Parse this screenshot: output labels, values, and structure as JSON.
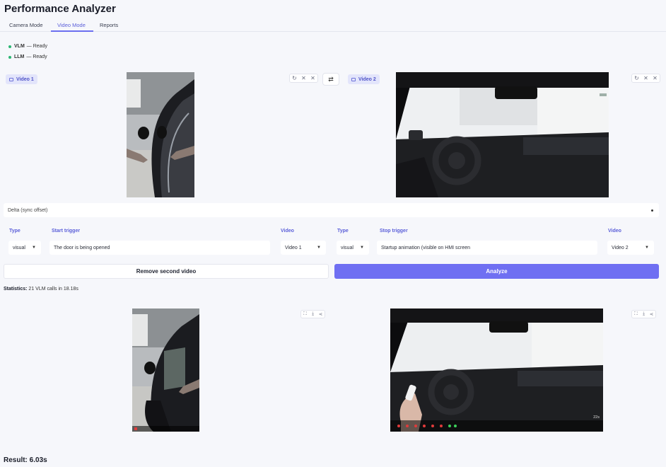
{
  "app": {
    "title": "Performance Analyzer"
  },
  "tabs": [
    {
      "label": "Camera Mode",
      "active": false
    },
    {
      "label": "Video Mode",
      "active": true
    },
    {
      "label": "Reports",
      "active": false
    }
  ],
  "status": [
    {
      "name": "VLM",
      "state": "— Ready"
    },
    {
      "name": "LLM",
      "state": "— Ready"
    }
  ],
  "videos": {
    "left": {
      "label": "Video 1"
    },
    "right": {
      "label": "Video 2"
    },
    "controls": {
      "reset_icon": "reset-icon",
      "close_icon": "close-icon"
    },
    "swap_icon": "swap-icon"
  },
  "delta": {
    "label": "Delta (sync offset)"
  },
  "start": {
    "type_label": "Type",
    "type_value": "visual",
    "trigger_label": "Start trigger",
    "trigger_value": "The door is being opened",
    "video_label": "Video",
    "video_value": "Video 1"
  },
  "stop": {
    "type_label": "Type",
    "type_value": "visual",
    "trigger_label": "Stop trigger",
    "trigger_value": "Startup animation (visible on HMI screen",
    "video_label": "Video",
    "video_value": "Video 2"
  },
  "buttons": {
    "remove": "Remove second video",
    "analyze": "Analyze"
  },
  "stats": {
    "label": "Statistics:",
    "value": "21 VLM calls in 18.18s"
  },
  "playback": {
    "right_time": "22s"
  },
  "result": {
    "text": "Result: 6.03s"
  },
  "colors": {
    "accent": "#6f6ff2",
    "ready": "#2bb673",
    "marker_red": "#e03b3b",
    "marker_green": "#3ccf5a"
  }
}
